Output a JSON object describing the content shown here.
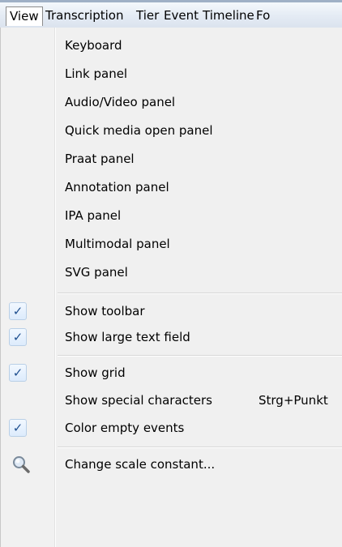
{
  "menubar": {
    "items": [
      {
        "label": "View"
      },
      {
        "label": "Transcription"
      },
      {
        "label": "Tier"
      },
      {
        "label": "Event"
      },
      {
        "label": "Timeline"
      },
      {
        "label": "Fo"
      }
    ]
  },
  "menu": {
    "panels": [
      {
        "label": "Keyboard"
      },
      {
        "label": "Link panel"
      },
      {
        "label": "Audio/Video panel"
      },
      {
        "label": "Quick media open panel"
      },
      {
        "label": "Praat panel"
      },
      {
        "label": "Annotation panel"
      },
      {
        "label": "IPA panel"
      },
      {
        "label": "Multimodal panel"
      },
      {
        "label": "SVG panel"
      }
    ],
    "show_toolbar": {
      "label": "Show toolbar",
      "checked": true
    },
    "show_large_text_field": {
      "label": "Show large text field",
      "checked": true
    },
    "show_grid": {
      "label": "Show grid",
      "checked": true
    },
    "show_special_characters": {
      "label": "Show special characters",
      "shortcut": "Strg+Punkt",
      "checked": false
    },
    "color_empty_events": {
      "label": "Color empty events",
      "checked": true
    },
    "change_scale_constant": {
      "label": "Change scale constant...",
      "icon": "magnifier-icon"
    },
    "check_glyph": "✓"
  }
}
